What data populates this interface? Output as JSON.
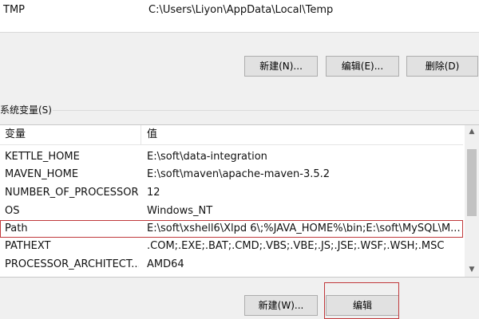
{
  "user_vars": {
    "rows": [
      {
        "name": "TMP",
        "value": "C:\\Users\\Liyon\\AppData\\Local\\Temp"
      }
    ],
    "buttons": {
      "new": "新建(N)...",
      "edit": "编辑(E)...",
      "delete": "删除(D)"
    }
  },
  "system_vars": {
    "label": "系统变量(S)",
    "headers": {
      "name": "变量",
      "value": "值"
    },
    "rows": [
      {
        "name": "KETTLE_HOME",
        "value": "E:\\soft\\data-integration"
      },
      {
        "name": "MAVEN_HOME",
        "value": "E:\\soft\\maven\\apache-maven-3.5.2"
      },
      {
        "name": "NUMBER_OF_PROCESSORS",
        "value": "12"
      },
      {
        "name": "OS",
        "value": "Windows_NT"
      },
      {
        "name": "Path",
        "value": "E:\\soft\\xshell6\\Xlpd 6\\;%JAVA_HOME%\\bin;E:\\soft\\MySQL\\M..."
      },
      {
        "name": "PATHEXT",
        "value": ".COM;.EXE;.BAT;.CMD;.VBS;.VBE;.JS;.JSE;.WSF;.WSH;.MSC"
      },
      {
        "name": "PROCESSOR_ARCHITECT...",
        "value": "AMD64"
      }
    ],
    "selected_row": "Path",
    "buttons": {
      "new": "新建(W)...",
      "edit": "编辑"
    }
  },
  "colors": {
    "highlight": "#c0393b"
  }
}
